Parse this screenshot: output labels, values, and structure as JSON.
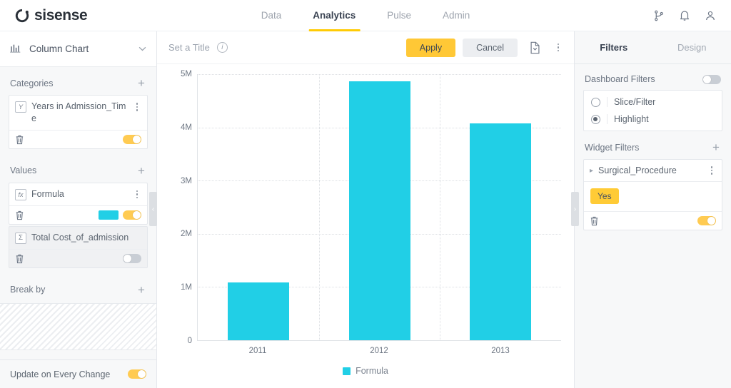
{
  "brand": {
    "name": "sisense",
    "logo_icon": "sisense-logo-icon"
  },
  "topnav": {
    "tabs": [
      {
        "label": "Data",
        "active": false
      },
      {
        "label": "Analytics",
        "active": true
      },
      {
        "label": "Pulse",
        "active": false
      },
      {
        "label": "Admin",
        "active": false
      }
    ],
    "icons": [
      "branch-icon",
      "bell-icon",
      "user-icon"
    ]
  },
  "left_panel": {
    "chart_type": {
      "label": "Column Chart",
      "icon": "column-chart-icon",
      "chevron": "chevron-down-icon"
    },
    "sections": [
      {
        "title": "Categories",
        "add_label": "+",
        "fields": [
          {
            "badge": "Y",
            "badge_kind": "years",
            "name": "Years in Admission_Time",
            "toggle_on": true,
            "has_color": false,
            "disabled": false
          }
        ]
      },
      {
        "title": "Values",
        "add_label": "+",
        "fields": [
          {
            "badge": "fx",
            "badge_kind": "formula",
            "name": "Formula",
            "toggle_on": true,
            "has_color": true,
            "color": "#21cfe6",
            "disabled": false
          },
          {
            "badge": "Σ",
            "badge_kind": "sum",
            "name": "Total Cost_of_admission",
            "toggle_on": false,
            "has_color": false,
            "disabled": true
          }
        ]
      },
      {
        "title": "Break by",
        "add_label": "+",
        "fields": []
      }
    ],
    "footer": {
      "label": "Update on Every Change",
      "toggle_on": true
    },
    "collapse_handle": "‹"
  },
  "toolbar": {
    "title_placeholder": "Set a Title",
    "info_label": "i",
    "apply_label": "Apply",
    "cancel_label": "Cancel",
    "export_icon": "export-document-icon",
    "menu_icon": "kebab-menu-icon"
  },
  "right_panel": {
    "tabs": [
      {
        "label": "Filters",
        "active": true
      },
      {
        "label": "Design",
        "active": false
      }
    ],
    "dashboard_filters": {
      "title": "Dashboard Filters",
      "toggle_on": false,
      "options": [
        {
          "label": "Slice/Filter",
          "selected": false
        },
        {
          "label": "Highlight",
          "selected": true
        }
      ]
    },
    "widget_filters": {
      "title": "Widget Filters",
      "add_label": "+",
      "items": [
        {
          "name": "Surgical_Procedure",
          "expand_icon": "chevron-right-icon",
          "chips": [
            "Yes"
          ],
          "toggle_on": true
        }
      ]
    },
    "collapse_handle": "›"
  },
  "chart_data": {
    "type": "bar",
    "title": "",
    "categories": [
      "2011",
      "2012",
      "2013"
    ],
    "values": [
      1080000,
      4870000,
      4080000
    ],
    "series": [
      {
        "name": "Formula",
        "color": "#21cfe6",
        "values": [
          1080000,
          4870000,
          4080000
        ]
      }
    ],
    "ytick_labels": [
      "0",
      "1M",
      "2M",
      "3M",
      "4M",
      "5M"
    ],
    "ytick_values": [
      0,
      1000000,
      2000000,
      3000000,
      4000000,
      5000000
    ],
    "ylim": [
      0,
      5000000
    ],
    "xlabel": "",
    "ylabel": "",
    "grid": true,
    "legend_position": "bottom",
    "legend": [
      "Formula"
    ]
  }
}
